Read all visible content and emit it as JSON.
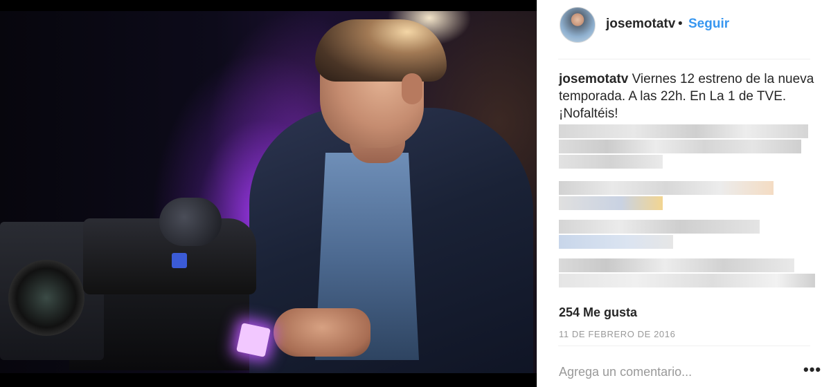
{
  "post": {
    "username": "josemotatv",
    "separator": "•",
    "follow_label": "Seguir",
    "caption_user": "josemotatv",
    "caption_text": " Viernes 12 estreno de la nueva temporada. A las 22h. En La 1 de TVE. ¡Nofaltéis!",
    "likes": "254 Me gusta",
    "date": "11 DE FEBRERO DE 2016",
    "comment_placeholder": "Agrega un comentario...",
    "more_label": "•••"
  },
  "icons": {
    "avatar": "profile-avatar",
    "more": "more-options-icon"
  },
  "colors": {
    "link": "#3897f0",
    "text": "#262626",
    "muted": "#999999"
  }
}
